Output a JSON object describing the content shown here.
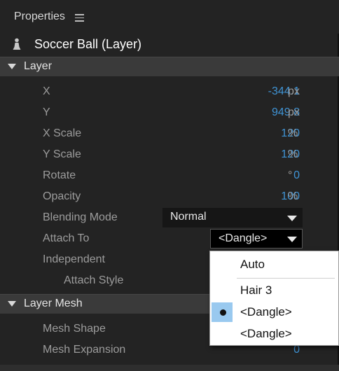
{
  "panel": {
    "title": "Properties",
    "object_name": "Soccer Ball (Layer)"
  },
  "sections": {
    "layer": {
      "label": "Layer"
    },
    "layer_mesh": {
      "label": "Layer Mesh"
    }
  },
  "layer_props": {
    "x": {
      "label": "X",
      "value": "-344.1",
      "unit": "px"
    },
    "y": {
      "label": "Y",
      "value": "949.8",
      "unit": "px"
    },
    "x_scale": {
      "label": "X Scale",
      "value": "120",
      "unit": "%"
    },
    "y_scale": {
      "label": "Y Scale",
      "value": "120",
      "unit": "%"
    },
    "rotate": {
      "label": "Rotate",
      "value": "0",
      "unit": "°"
    },
    "opacity": {
      "label": "Opacity",
      "value": "100",
      "unit": "%"
    },
    "blending_mode": {
      "label": "Blending Mode",
      "value": "Normal"
    },
    "attach_to": {
      "label": "Attach To",
      "value": "<Dangle>"
    },
    "independent": {
      "label": "Independent"
    },
    "attach_style": {
      "label": "Attach Style"
    }
  },
  "mesh_props": {
    "mesh_shape": {
      "label": "Mesh Shape"
    },
    "mesh_expansion": {
      "label": "Mesh Expansion",
      "value": "0"
    }
  },
  "dropdown": {
    "items": [
      {
        "label": "Auto",
        "selected": false
      },
      {
        "label": "Hair 3",
        "selected": false
      },
      {
        "label": "<Dangle>",
        "selected": true
      },
      {
        "label": "<Dangle>",
        "selected": false
      }
    ]
  },
  "colors": {
    "accent_value": "#3f94d6",
    "selection_highlight": "#99c9ef",
    "panel_bg": "#232323"
  },
  "icons": {
    "menu": "hamburger-menu-icon",
    "layer": "puppet-layer-icon",
    "disclosure": "triangle-down-icon",
    "caret": "chevron-down-icon",
    "selected": "bullet-icon"
  }
}
